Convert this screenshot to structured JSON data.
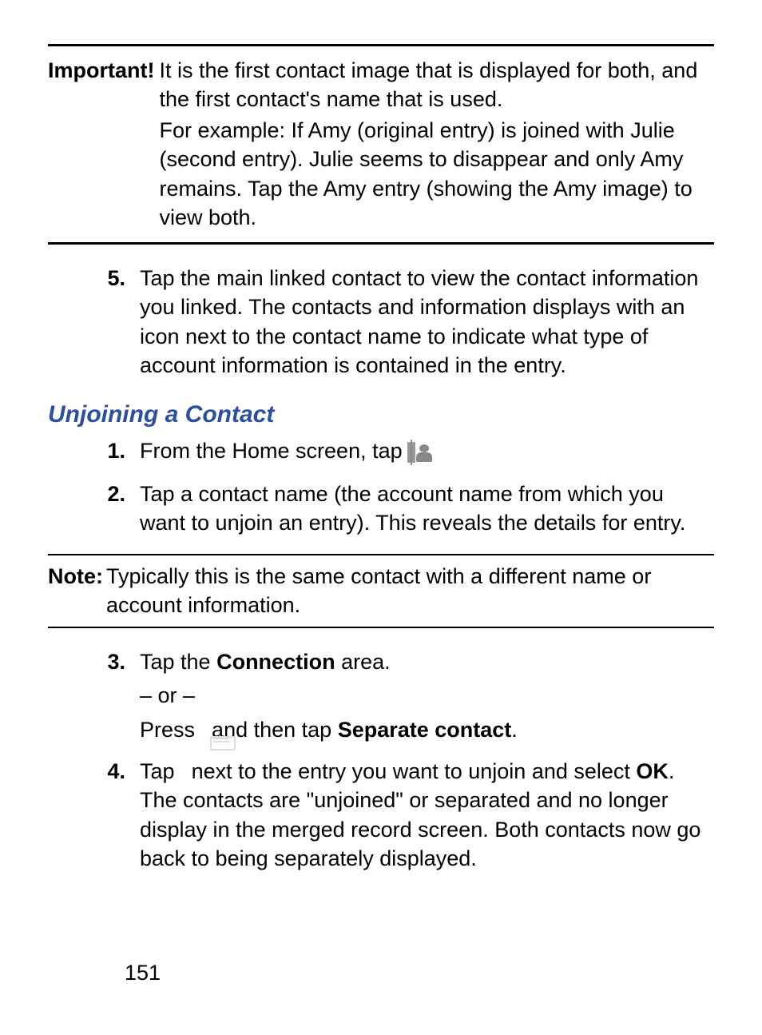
{
  "important": {
    "label": "Important!",
    "para1": "It is the first contact image that is displayed for both, and the first contact's name that is used.",
    "para2": "For example: If Amy (original entry) is joined with Julie (second entry). Julie seems to disappear and only Amy remains. Tap the Amy entry (showing the Amy image) to view both."
  },
  "step5": {
    "marker": "5.",
    "text": "Tap the main linked contact to view the contact information you linked. The contacts and information displays with an icon next to the contact name to indicate what type of account information is contained in the entry."
  },
  "section_heading": "Unjoining a Contact",
  "unjoin": {
    "s1": {
      "marker": "1.",
      "pre": "From the Home screen, tap ",
      "post": "."
    },
    "s2": {
      "marker": "2.",
      "text": "Tap a contact name (the account name from which you want to unjoin an entry). This reveals the details for entry."
    },
    "s3": {
      "marker": "3.",
      "line1_pre": "Tap the ",
      "line1_bold": "Connection",
      "line1_post": " area.",
      "or": "– or –",
      "line2_pre": "Press ",
      "line2_mid": " and then tap ",
      "line2_bold": "Separate contact",
      "line2_post": "."
    },
    "s4": {
      "marker": "4.",
      "pre": "Tap ",
      "mid": " next to the entry you want to unjoin and select ",
      "bold": "OK",
      "post": ". The contacts are \"unjoined\" or separated and no longer display in the merged record screen. Both contacts now go back to being separately displayed."
    }
  },
  "note": {
    "label": "Note:",
    "text": "Typically this is the same contact with a different name or account information."
  },
  "page_number": "151"
}
